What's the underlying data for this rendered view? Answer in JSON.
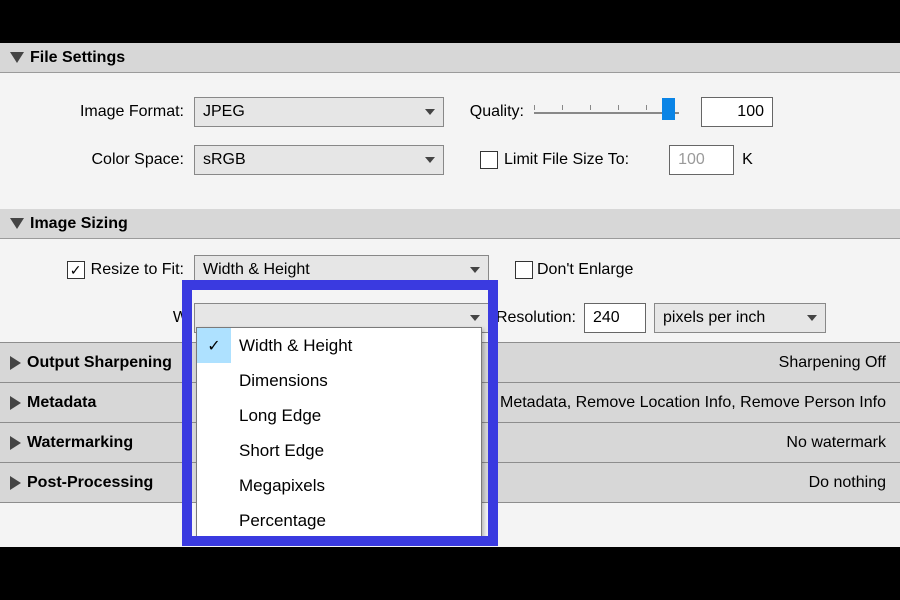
{
  "file_settings": {
    "title": "File Settings",
    "image_format_label": "Image Format:",
    "image_format_value": "JPEG",
    "quality_label": "Quality:",
    "quality_value": "100",
    "color_space_label": "Color Space:",
    "color_space_value": "sRGB",
    "limit_checkbox_label": "Limit File Size To:",
    "limit_value": "100",
    "limit_unit": "K"
  },
  "image_sizing": {
    "title": "Image Sizing",
    "resize_label": "Resize to Fit:",
    "resize_combo_value": "Width & Height",
    "dont_enlarge_label": "Don't Enlarge",
    "w_label": "W",
    "resolution_label": "Resolution:",
    "resolution_value": "240",
    "resolution_units": "pixels per inch",
    "dropdown_options": [
      "Width & Height",
      "Dimensions",
      "Long Edge",
      "Short Edge",
      "Megapixels",
      "Percentage"
    ]
  },
  "collapsed": {
    "sharpening_title": "Output Sharpening",
    "sharpening_status": "Sharpening Off",
    "metadata_title": "Metadata",
    "metadata_status": "Metadata, Remove Location Info, Remove Person Info",
    "watermarking_title": "Watermarking",
    "watermarking_status": "No watermark",
    "postproc_title": "Post-Processing",
    "postproc_status": "Do nothing"
  }
}
